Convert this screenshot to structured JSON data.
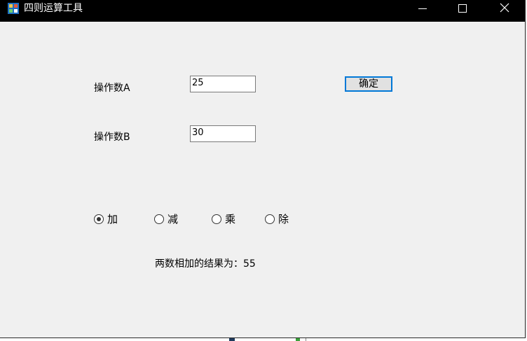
{
  "window": {
    "title": "四则运算工具"
  },
  "form": {
    "label_a": "操作数A",
    "label_b": "操作数B",
    "value_a": "25",
    "value_b": "30",
    "confirm_label": "确定"
  },
  "operations": [
    {
      "label": "加",
      "selected": true
    },
    {
      "label": "减",
      "selected": false
    },
    {
      "label": "乘",
      "selected": false
    },
    {
      "label": "除",
      "selected": false
    }
  ],
  "result": {
    "text": "两数相加的结果为：55"
  },
  "colors": {
    "titlebar": "#000000",
    "background": "#f0f0f0",
    "focus_border": "#0078d7"
  }
}
